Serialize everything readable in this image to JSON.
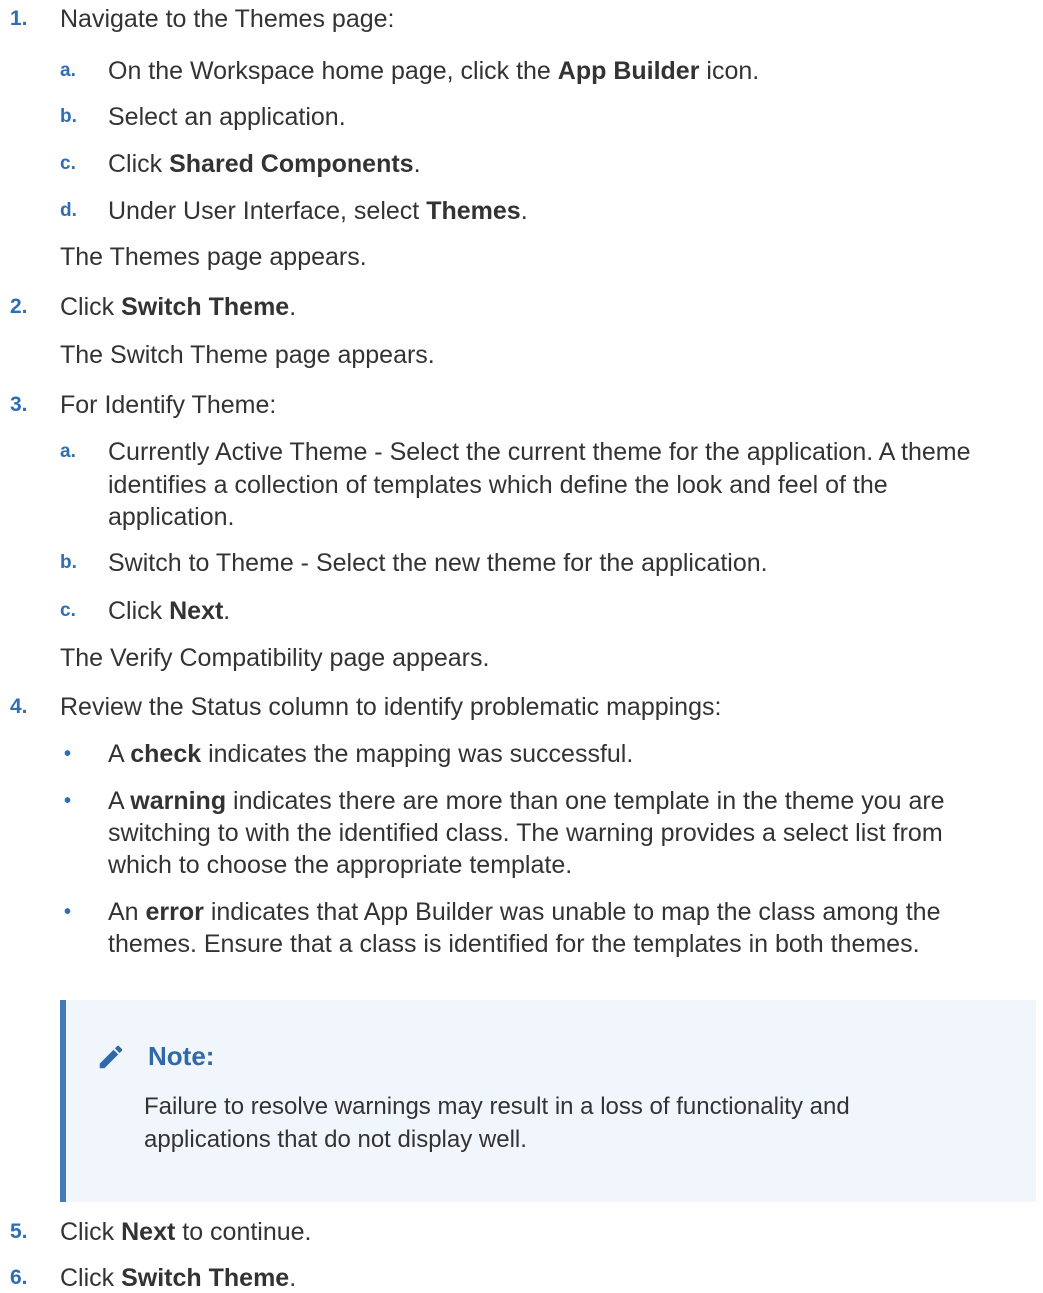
{
  "steps": [
    {
      "number": "1.",
      "text": "Navigate to the Themes page:",
      "substeps": [
        {
          "letter": "a.",
          "before": "On the Workspace home page, click the ",
          "bold": "App Builder",
          "after": " icon."
        },
        {
          "letter": "b.",
          "text": "Select an application."
        },
        {
          "letter": "c.",
          "before": "Click ",
          "bold": "Shared Components",
          "after": "."
        },
        {
          "letter": "d.",
          "before": "Under User Interface, select ",
          "bold": "Themes",
          "after": "."
        }
      ],
      "result": "The Themes page appears."
    },
    {
      "number": "2.",
      "before": "Click ",
      "bold": "Switch Theme",
      "after": ".",
      "result": "The Switch Theme page appears."
    },
    {
      "number": "3.",
      "text": "For Identify Theme:",
      "substeps": [
        {
          "letter": "a.",
          "lines": [
            "Currently Active Theme - Select the current theme for the application. A theme",
            "identifies a collection of templates which define the look and feel of the",
            "application."
          ]
        },
        {
          "letter": "b.",
          "text": "Switch to Theme - Select the new theme for the application."
        },
        {
          "letter": "c.",
          "before": "Click ",
          "bold": "Next",
          "after": "."
        }
      ],
      "result": "The Verify Compatibility page appears."
    },
    {
      "number": "4.",
      "text": "Review the Status column to identify problematic mappings:",
      "bullets": [
        {
          "marker": "•",
          "before": "A ",
          "bold": "check",
          "after": " indicates the mapping was successful."
        },
        {
          "marker": "•",
          "before": "A ",
          "bold": "warning",
          "after": " indicates there are more than one template in the theme you are",
          "lines": [
            "switching to with the identified class. The warning provides a select list from",
            "which to choose the appropriate template."
          ]
        },
        {
          "marker": "•",
          "before": "An ",
          "bold": "error",
          "after": " indicates that App Builder was unable to map the class among the",
          "lines": [
            "themes. Ensure that a class is identified for the templates in both themes."
          ]
        }
      ]
    },
    {
      "number": "5.",
      "before": "Click ",
      "bold": "Next",
      "after": " to continue."
    },
    {
      "number": "6.",
      "before": "Click ",
      "bold": "Switch Theme",
      "after": "."
    }
  ],
  "note": {
    "icon": "pencil-icon",
    "title": "Note:",
    "lines": [
      "Failure to resolve warnings may result in a loss of functionality and",
      "applications that do not display well."
    ]
  },
  "colors": {
    "accent": "#2e6eb5",
    "note_background": "#f1f6fc",
    "note_border": "#4679b7",
    "text": "#333333"
  }
}
